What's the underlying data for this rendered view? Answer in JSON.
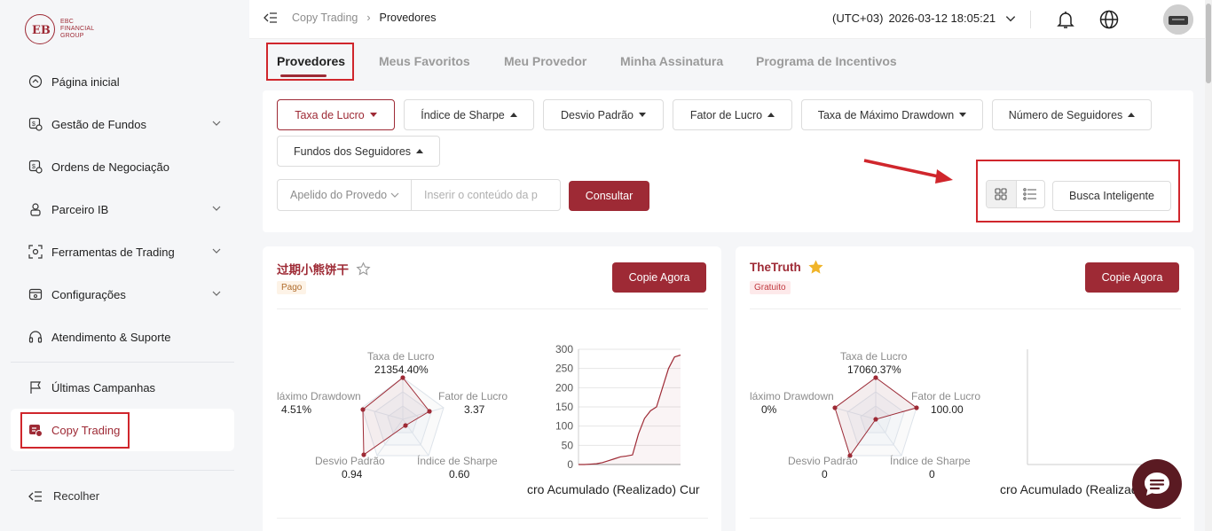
{
  "brand": {
    "logo_mark": "EBC",
    "logo_line1": "EBC",
    "logo_line2": "FINANCIAL",
    "logo_line3": "GROUP",
    "accent": "#9e2a35"
  },
  "sidebar": {
    "items": [
      {
        "label": "Página inicial",
        "icon": "home-icon"
      },
      {
        "label": "Gestão de Fundos",
        "icon": "fund-icon"
      },
      {
        "label": "Ordens de Negociação",
        "icon": "orders-icon"
      },
      {
        "label": "Parceiro IB",
        "icon": "partner-icon"
      },
      {
        "label": "Ferramentas de Trading",
        "icon": "tools-icon"
      },
      {
        "label": "Configurações",
        "icon": "settings-icon"
      },
      {
        "label": "Atendimento & Suporte",
        "icon": "headset-icon"
      },
      {
        "label": "Últimas Campanhas",
        "icon": "flag-icon"
      },
      {
        "label": "Copy Trading",
        "icon": "copy-trading-icon"
      }
    ],
    "collapse_label": "Recolher"
  },
  "header": {
    "breadcrumb_parent": "Copy Trading",
    "breadcrumb_current": "Provedores",
    "timezone": "(UTC+03)",
    "datetime": "2026-03-12 18:05:21"
  },
  "tabs": [
    "Provedores",
    "Meus Favoritos",
    "Meu Provedor",
    "Minha Assinatura",
    "Programa de Incentivos"
  ],
  "filters": {
    "sort_buttons": [
      "Taxa de Lucro",
      "Índice de Sharpe",
      "Desvio Padrão",
      "Fator de Lucro",
      "Taxa de Máximo Drawdown",
      "Número de Seguidores",
      "Fundos dos Seguidores"
    ],
    "search_select": "Apelido do Provedo",
    "search_placeholder": "Inserir o conteúdo da p",
    "consult_label": "Consultar",
    "smart_search_label": "Busca Inteligente"
  },
  "cards": [
    {
      "name": "过期小熊饼干",
      "badge": "Pago",
      "favorited": false,
      "copy_label": "Copie Agora",
      "radar": {
        "labels": [
          "Taxa de Lucro",
          "Fator de Lucro",
          "Índice de Sharpe",
          "Desvio Padrão",
          "láximo Drawdown"
        ],
        "values": [
          "21354.40%",
          "3.37",
          "0.60",
          "0.94",
          "4.51%"
        ]
      },
      "chart_title": "cro Acumulado (Realizado) Cur"
    },
    {
      "name": "TheTruth",
      "badge": "Gratuito",
      "favorited": true,
      "copy_label": "Copie Agora",
      "radar": {
        "labels": [
          "Taxa de Lucro",
          "Fator de Lucro",
          "Índice de Sharpe",
          "Desvio Padrão",
          "láximo Drawdown"
        ],
        "values": [
          "17060.37%",
          "100.00",
          "0",
          "0",
          "0%"
        ]
      },
      "chart_title": "cro Acumulado (Realizado)"
    }
  ],
  "chart_data": {
    "type": "line",
    "ylim": [
      0,
      300
    ],
    "y_ticks": [
      "300",
      "250",
      "200",
      "150",
      "100",
      "50",
      "0"
    ],
    "series": [
      {
        "values": [
          0,
          0,
          1,
          2,
          5,
          10,
          15,
          20,
          22,
          25,
          80,
          120,
          140,
          150,
          200,
          250,
          280,
          285
        ]
      }
    ],
    "grid": true
  }
}
